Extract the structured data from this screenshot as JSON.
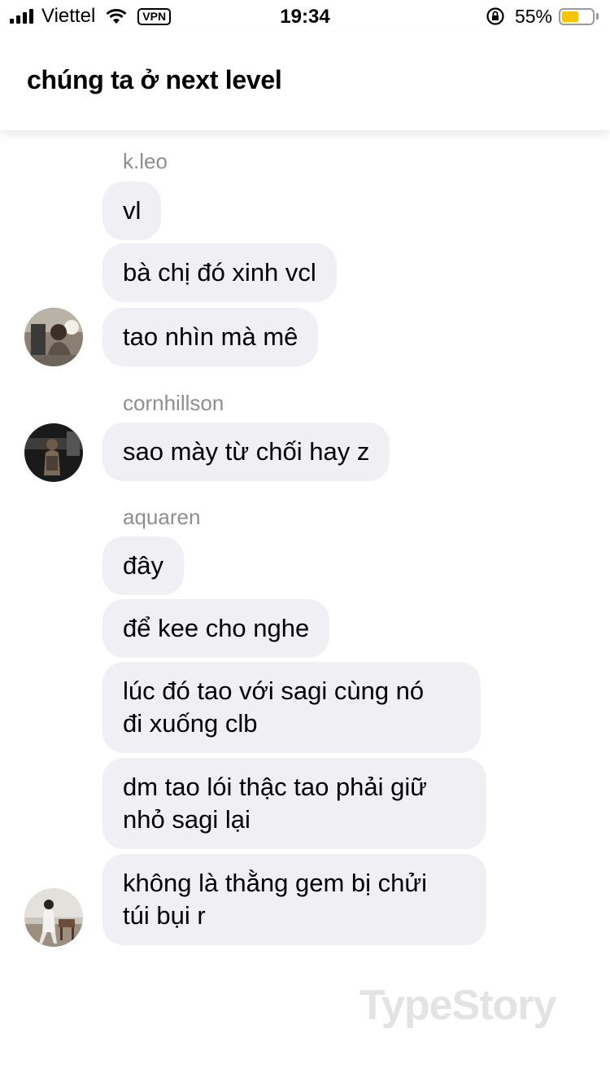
{
  "status_bar": {
    "carrier": "Viettel",
    "vpn": "VPN",
    "time": "19:34",
    "battery_percent": "55%",
    "battery_level": 0.55,
    "battery_color": "#f5c400",
    "icons": [
      "signal-icon",
      "wifi-icon",
      "rotation-lock-icon",
      "battery-icon"
    ]
  },
  "header": {
    "title": "chúng ta ở next level"
  },
  "messages": {
    "group1": {
      "sender": "k.leo",
      "bubbles": [
        "vl",
        "bà chị đó xinh vcl",
        "tao nhìn mà mê"
      ]
    },
    "group2": {
      "sender": "cornhillson",
      "bubbles": [
        "sao mày từ chối hay z"
      ]
    },
    "group3": {
      "sender": "aquaren",
      "bubbles": [
        "đây",
        "để kee cho nghe",
        [
          "lúc đó tao với sagi cùng nó",
          "đi xuống clb"
        ],
        [
          "dm tao lói thậc tao phải giữ",
          "nhỏ sagi lại"
        ],
        [
          "không là thằng gem bị chửi",
          "túi bụi r"
        ]
      ]
    }
  },
  "watermark": "TypeStory",
  "colors": {
    "bubble": "#efeff4",
    "sender_name": "#8e8e93",
    "watermark": "#e3e3e3"
  }
}
